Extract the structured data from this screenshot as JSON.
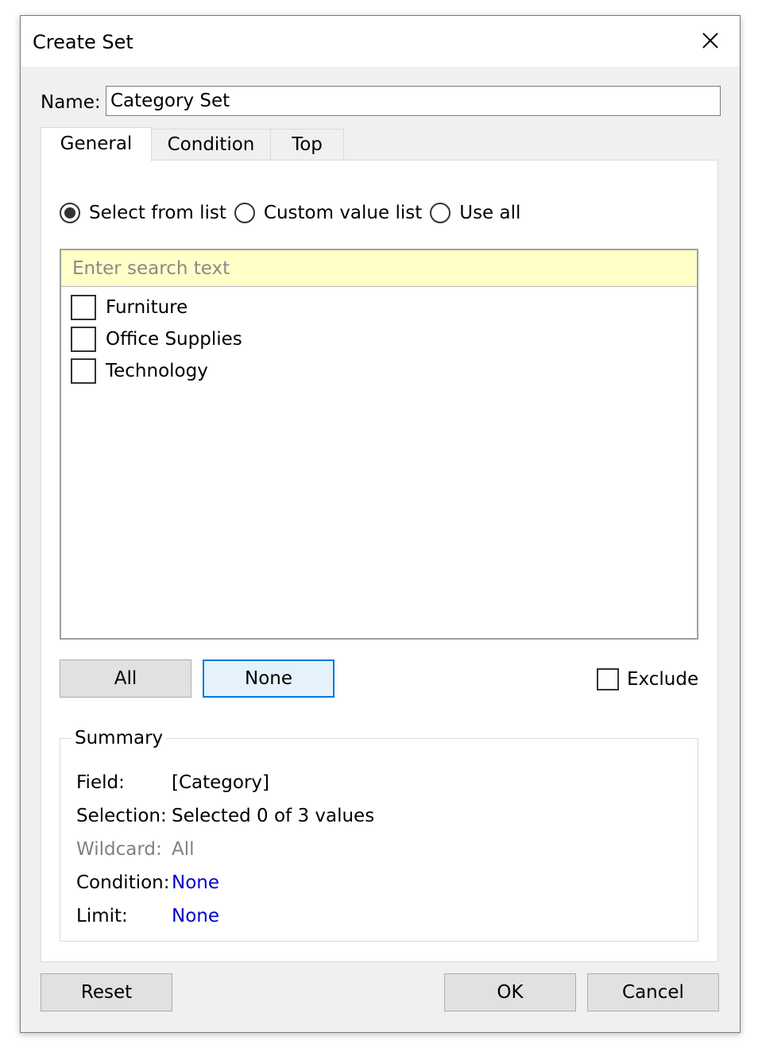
{
  "dialog": {
    "title": "Create Set"
  },
  "name": {
    "label": "Name:",
    "value": "Category Set"
  },
  "tabs": [
    {
      "label": "General",
      "active": true
    },
    {
      "label": "Condition",
      "active": false
    },
    {
      "label": "Top",
      "active": false
    }
  ],
  "general": {
    "radios": [
      {
        "label": "Select from list",
        "selected": true
      },
      {
        "label": "Custom value list",
        "selected": false
      },
      {
        "label": "Use all",
        "selected": false
      }
    ],
    "search_placeholder": "Enter search text",
    "items": [
      {
        "label": "Furniture",
        "checked": false
      },
      {
        "label": "Office Supplies",
        "checked": false
      },
      {
        "label": "Technology",
        "checked": false
      }
    ],
    "all_label": "All",
    "none_label": "None",
    "exclude_label": "Exclude"
  },
  "summary": {
    "title": "Summary",
    "rows": [
      {
        "key": "Field:",
        "value": "[Category]"
      },
      {
        "key": "Selection:",
        "value": "Selected 0 of 3 values"
      },
      {
        "key": "Wildcard:",
        "value": "All"
      },
      {
        "key": "Condition:",
        "value": "None"
      },
      {
        "key": "Limit:",
        "value": "None"
      }
    ]
  },
  "footer": {
    "reset_label": "Reset",
    "ok_label": "OK",
    "cancel_label": "Cancel"
  },
  "colors": {
    "link": "#0000cc",
    "search_bg": "#ffffc8",
    "focus_border": "#0078d7"
  }
}
